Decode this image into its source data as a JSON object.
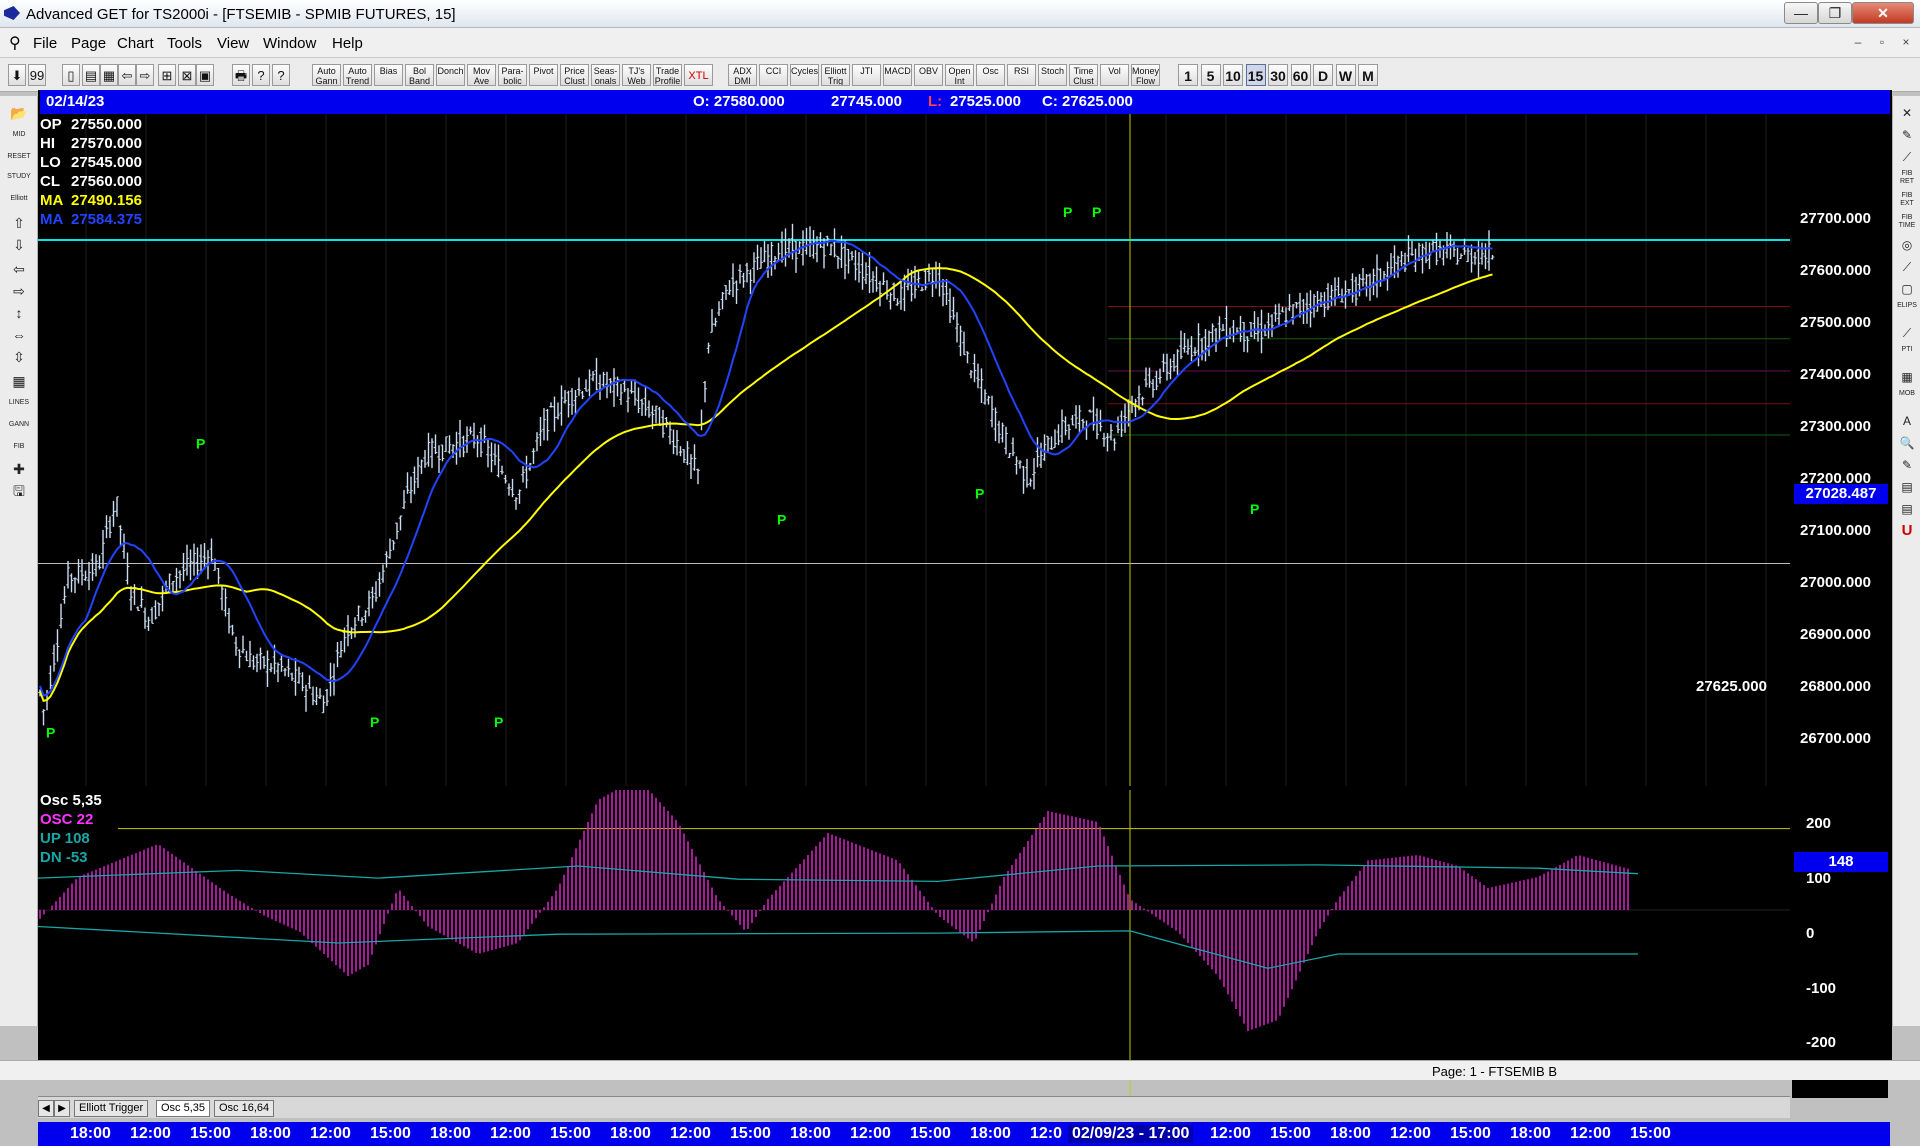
{
  "window": {
    "title": "Advanced GET for TS2000i - [FTSEMIB - SPMIB FUTURES, 15]",
    "buttons": [
      "—",
      "❐",
      "✕"
    ]
  },
  "mdi_buttons": [
    "–",
    "▫",
    "×"
  ],
  "menu": [
    "File",
    "Page",
    "Chart",
    "Tools",
    "View",
    "Window",
    "Help"
  ],
  "toolbar": {
    "icons": [
      "⬇",
      "99",
      "▯",
      "▤",
      "▦",
      "⇦",
      "⇨",
      "⊞",
      "⊠",
      "▣",
      "🖶",
      "?",
      "?"
    ],
    "study_buttons": [
      "Auto Gann",
      "Auto Trend",
      "Bias",
      "Bol Band",
      "Donch",
      "Mov Ave",
      "Para- bolic",
      "Pivot",
      "Price Clust",
      "Seas- onals",
      "TJ's Web",
      "Trade Profile",
      "XTL",
      "ADX DMI",
      "CCI",
      "Cycles",
      "Elliott Trig",
      "JTI",
      "MACD",
      "OBV",
      "Open Int",
      "Osc",
      "RSI",
      "Stoch",
      "Time Clust",
      "Vol",
      "Money Flow"
    ],
    "intervals": [
      "1",
      "5",
      "10",
      "15",
      "30",
      "60",
      "D",
      "W",
      "M"
    ],
    "selected_interval": "15"
  },
  "left_tools": [
    "📂",
    "MID",
    "RESET",
    "STUDY",
    "Elliott",
    "⇧",
    "⇩",
    "⇦",
    "⇨",
    "↕",
    "⇔",
    "⇳",
    "▦",
    "LINES",
    "GANN",
    "FIB",
    "✚",
    "🖫"
  ],
  "right_tools": [
    "✕",
    "✎",
    "⟋",
    "FIB RET",
    "FIB EXT",
    "FIB TIME",
    "◎",
    "⟋",
    "▢",
    "ELIPS",
    "⟋",
    "PTI",
    "▦",
    "MOB",
    "A",
    "🔍",
    "✎",
    "▤",
    "▤",
    "U"
  ],
  "info": {
    "date": "02/14/23",
    "open": "O: 27580.000",
    "high": "27745.000",
    "low_label": "L:",
    "low": "27525.000",
    "close": "C: 27625.000"
  },
  "price_legend": [
    {
      "label": "OP",
      "value": "27550.000",
      "color": "#ffffff"
    },
    {
      "label": "HI",
      "value": "27570.000",
      "color": "#ffffff"
    },
    {
      "label": "LO",
      "value": "27545.000",
      "color": "#ffffff"
    },
    {
      "label": "CL",
      "value": "27560.000",
      "color": "#ffffff"
    },
    {
      "label": "MA",
      "value": "27490.156",
      "color": "#ffff00"
    },
    {
      "label": "MA",
      "value": "27584.375",
      "color": "#2244ff"
    }
  ],
  "price_axis": {
    "ticks": [
      "27700.000",
      "27600.000",
      "27500.000",
      "27400.000",
      "27300.000",
      "27200.000",
      "27100.000",
      "27000.000",
      "26900.000",
      "26800.000",
      "26700.000"
    ],
    "cursor_label": "27028.487",
    "last_price": "27625.000"
  },
  "pivot_labels": [
    "P",
    "P",
    "P",
    "P",
    "P",
    "P",
    "P",
    "P",
    "P"
  ],
  "osc_legend": [
    {
      "label": "Osc 5,35",
      "color": "#ffffff"
    },
    {
      "label": "OSC 22",
      "color": "#ff33ff"
    },
    {
      "label": "UP   108",
      "color": "#19a6a6"
    },
    {
      "label": "DN   -53",
      "color": "#19a6a6"
    }
  ],
  "osc_axis": {
    "ticks": [
      "200",
      "100",
      "0",
      "-100",
      "-200"
    ],
    "cursor_label": "148"
  },
  "tabs": [
    "Elliott Trigger",
    "Osc 5,35",
    "Osc 16,64"
  ],
  "active_tab": "Osc 5,35",
  "time_axis": {
    "labels": [
      "18:00",
      "12:00",
      "15:00",
      "18:00",
      "12:00",
      "15:00",
      "18:00",
      "12:00",
      "15:00",
      "18:00",
      "12:00",
      "15:00",
      "18:00",
      "12:00",
      "15:00",
      "18:00",
      "12:0",
      "12:00",
      "15:00",
      "18:00",
      "12:00",
      "15:00",
      "18:00",
      "12:00",
      "15:00"
    ],
    "cursor": "02/09/23 - 17:00"
  },
  "status": "Page: 1 - FTSEMIB B",
  "colors": {
    "bars": "#c9dcf2",
    "ma_fast": "#ffff00",
    "ma_slow": "#2244ff",
    "pivot": "#00ff00",
    "osc": "#dd22cc",
    "band": "#19a6a6",
    "cursor_line": "#c8c800",
    "resistance": "#00e5e5",
    "info_bg": "#0000ee"
  }
}
